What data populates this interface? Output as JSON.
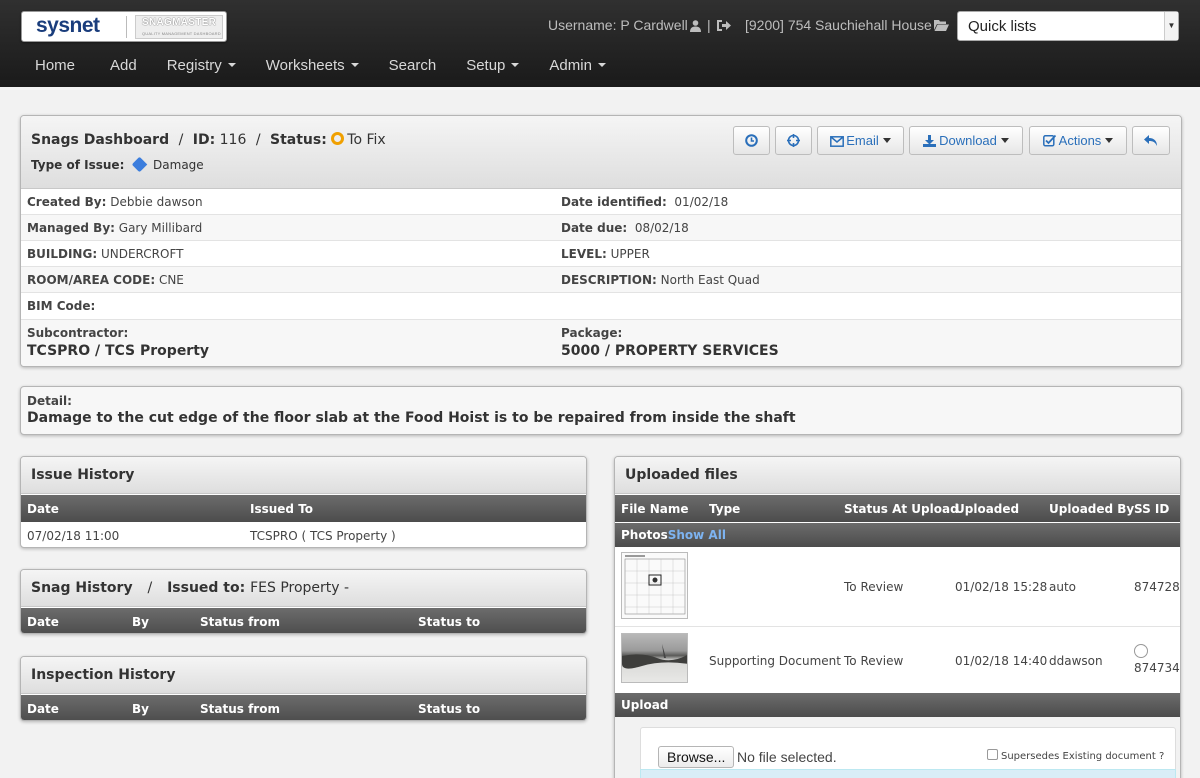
{
  "header": {
    "logo_main": "sysnet",
    "logo_brand": "SNAGMASTER",
    "logo_tagline": "QUALITY MANAGEMENT DASHBOARD",
    "username": "Username: P Cardwell",
    "separator": "|",
    "project": "[9200] 754 Sauchiehall House",
    "quick_lists": "Quick lists"
  },
  "nav": {
    "home": "Home",
    "add": "Add",
    "registry": "Registry",
    "worksheets": "Worksheets",
    "search": "Search",
    "setup": "Setup",
    "admin": "Admin"
  },
  "dashboard": {
    "title": "Snags Dashboard",
    "slash1": "/",
    "id_label": "ID:",
    "id_value": "116",
    "slash2": "/",
    "status_label": "Status:",
    "status_value": "To Fix",
    "type_label": "Type of Issue:",
    "type_value": "Damage",
    "buttons": {
      "email": "Email",
      "download": "Download",
      "actions": "Actions"
    },
    "fields": {
      "created_by_label": "Created By:",
      "created_by": "Debbie dawson",
      "date_identified_label": "Date identified:",
      "date_identified": "01/02/18",
      "managed_by_label": "Managed By:",
      "managed_by": "Gary Millibard",
      "date_due_label": "Date due:",
      "date_due": "08/02/18",
      "building_label": "BUILDING:",
      "building": "UNDERCROFT",
      "level_label": "LEVEL:",
      "level": "UPPER",
      "room_label": "ROOM/AREA CODE:",
      "room": "CNE",
      "description_label": "DESCRIPTION:",
      "description": "North East Quad",
      "bim_label": "BIM Code:",
      "subcontractor_label": "Subcontractor:",
      "subcontractor": "TCSPRO / TCS Property",
      "package_label": "Package:",
      "package": "5000 / PROPERTY SERVICES"
    }
  },
  "detail": {
    "label": "Detail:",
    "text": "Damage to the cut edge of the floor slab at the Food Hoist is to be repaired from inside the shaft"
  },
  "issue_history": {
    "title": "Issue History",
    "columns": [
      "Date",
      "Issued To"
    ],
    "rows": [
      {
        "date": "07/02/18 11:00",
        "issued_to": "TCSPRO ( TCS Property )"
      }
    ]
  },
  "snag_history": {
    "title": "Snag History",
    "slash": "/",
    "issued_label": "Issued to:",
    "issued_value": "FES Property -",
    "columns": [
      "Date",
      "By",
      "Status from",
      "Status to"
    ]
  },
  "inspection_history": {
    "title": "Inspection History",
    "columns": [
      "Date",
      "By",
      "Status from",
      "Status to"
    ]
  },
  "uploaded_files": {
    "title": "Uploaded files",
    "columns": [
      "File Name",
      "Type",
      "Status At Upload",
      "Uploaded",
      "Uploaded By",
      "SS ID"
    ],
    "photos_label": "Photos",
    "show_all": "Show All",
    "rows": [
      {
        "type": "",
        "status": "To Review",
        "uploaded": "01/02/18 15:28",
        "by": "auto",
        "ssid": "874728"
      },
      {
        "type": "Supporting Document",
        "status": "To Review",
        "uploaded": "01/02/18 14:40",
        "by": "ddawson",
        "ssid": "874734"
      }
    ],
    "upload_label": "Upload",
    "browse": "Browse...",
    "no_file": "No file selected.",
    "supersedes": "Supersedes Existing document ?"
  },
  "colors": {
    "accent": "#2a6fba",
    "status_to_fix": "#f0a000",
    "tag": "#3b7ddd",
    "table_header": "#555555"
  }
}
